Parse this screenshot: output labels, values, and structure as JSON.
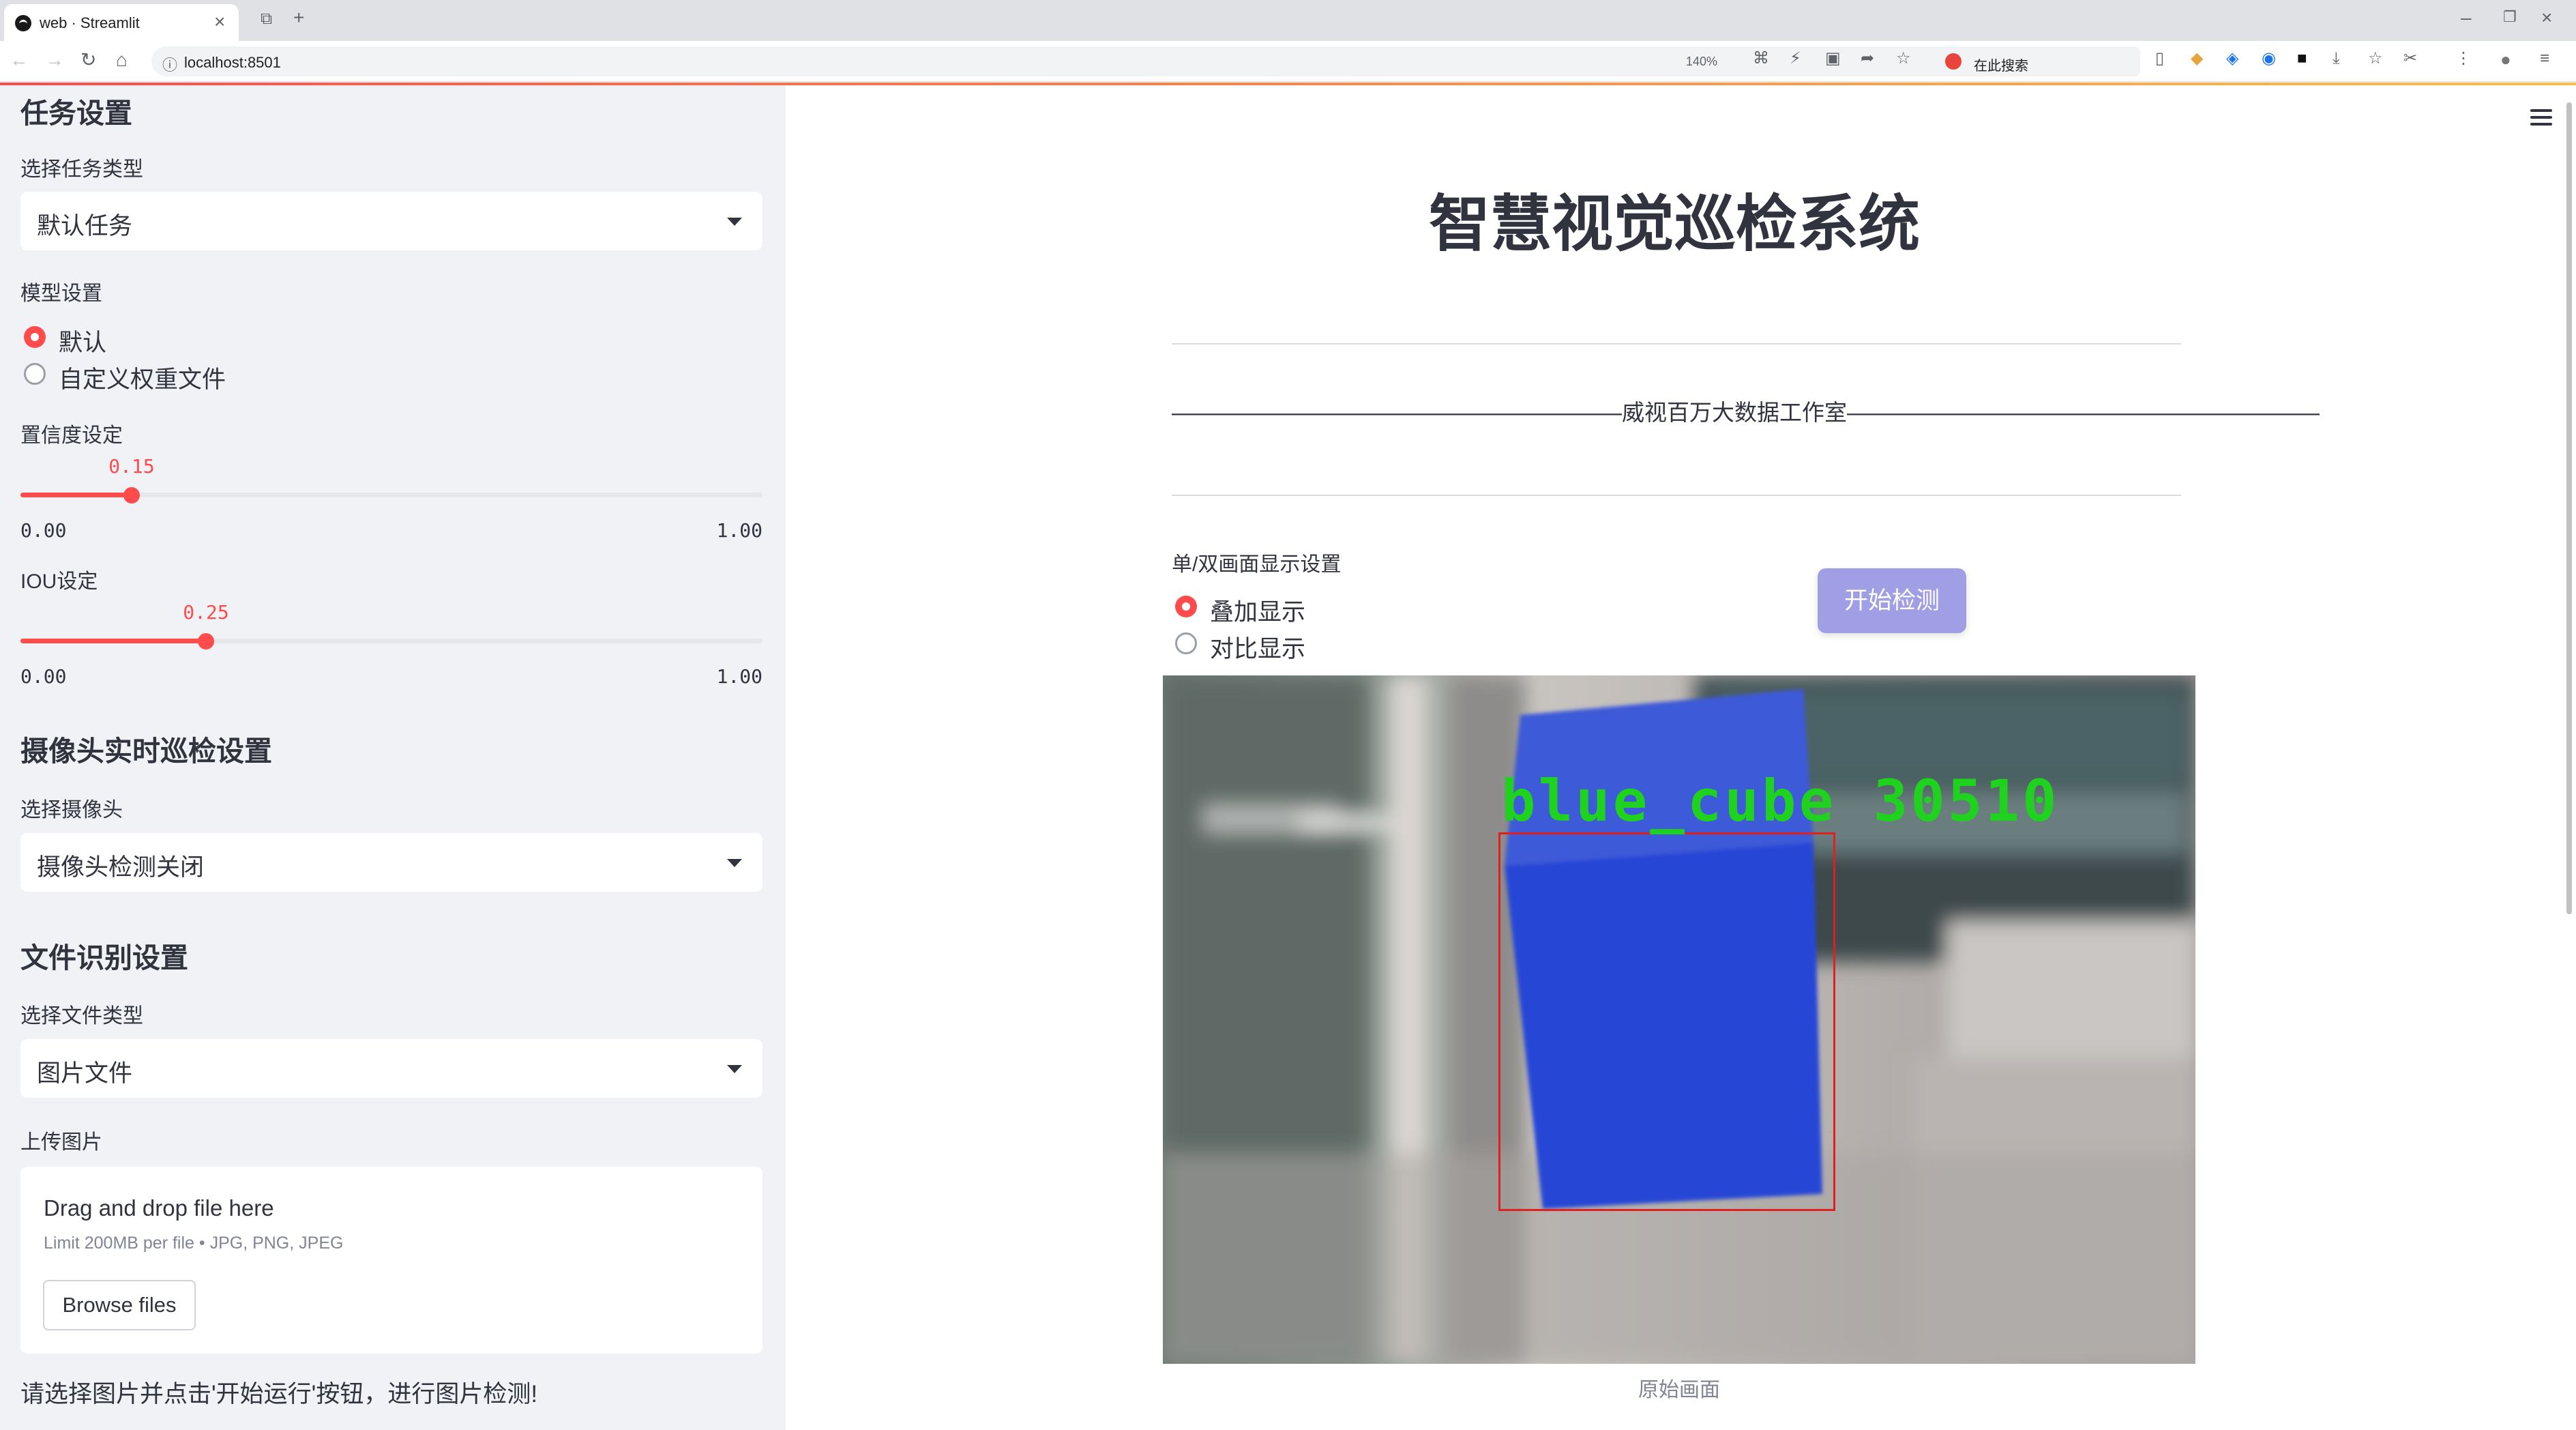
{
  "browser": {
    "tab_title": "web · Streamlit",
    "url": "localhost:8501",
    "zoom": "140%",
    "search_placeholder": "在此搜索"
  },
  "sidebar": {
    "task_section": "任务设置",
    "task_type_label": "选择任务类型",
    "task_type_value": "默认任务",
    "model_label": "模型设置",
    "model_options": [
      "默认",
      "自定义权重文件"
    ],
    "model_selected": 0,
    "conf_label": "置信度设定",
    "conf_value": "0.15",
    "conf_fraction": 0.15,
    "conf_min": "0.00",
    "conf_max": "1.00",
    "iou_label": "IOU设定",
    "iou_value": "0.25",
    "iou_fraction": 0.25,
    "iou_min": "0.00",
    "iou_max": "1.00",
    "camera_section": "摄像头实时巡检设置",
    "camera_label": "选择摄像头",
    "camera_value": "摄像头检测关闭",
    "file_section": "文件识别设置",
    "file_type_label": "选择文件类型",
    "file_type_value": "图片文件",
    "upload_label": "上传图片",
    "upload_title": "Drag and drop file here",
    "upload_limit": "Limit 200MB per file • JPG, PNG, JPEG",
    "browse_label": "Browse files",
    "hint": "请选择图片并点击'开始运行'按钮，进行图片检测!"
  },
  "main": {
    "title": "智慧视觉巡检系统",
    "banner": "————————————————————威视百万大数据工作室—————————————————————",
    "display_label": "单/双画面显示设置",
    "display_options": [
      "叠加显示",
      "对比显示"
    ],
    "display_selected": 0,
    "start_button": "开始检测",
    "detection_label": "blue_cube 30510",
    "caption": "原始画面"
  },
  "colors": {
    "accent": "#ff4b4b",
    "button": "#a09fe6",
    "box": "#e0201e",
    "label": "#1ed21e",
    "cube": "#3a5ae6"
  }
}
